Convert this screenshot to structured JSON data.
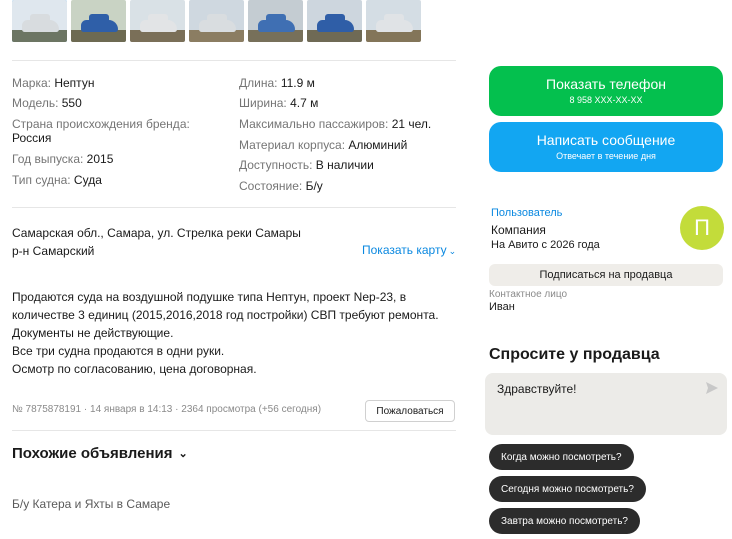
{
  "gallery": {
    "thumbnails": [
      {
        "name": "photo-1",
        "sky": "#dfe7ee",
        "boat": "#d8dcdf",
        "grass": "#6c7563"
      },
      {
        "name": "photo-2",
        "sky": "#c9d3c4",
        "boat": "#2f5fa8",
        "grass": "#6d6a52"
      },
      {
        "name": "photo-3",
        "sky": "#d9e1e6",
        "boat": "#e2e4e6",
        "grass": "#7a6f58"
      },
      {
        "name": "photo-4",
        "sky": "#cfd8e0",
        "boat": "#d9dde0",
        "grass": "#8b7d62"
      },
      {
        "name": "photo-5",
        "sky": "#c4ccd2",
        "boat": "#3f6fb3",
        "grass": "#77705a"
      },
      {
        "name": "photo-6",
        "sky": "#cdd6de",
        "boat": "#2f5ea7",
        "grass": "#6f6a55"
      },
      {
        "name": "photo-7",
        "sky": "#d4dde4",
        "boat": "#e0e3e6",
        "grass": "#837559"
      }
    ]
  },
  "specs": {
    "left": [
      {
        "key": "Марка:",
        "value": "Нептун"
      },
      {
        "key": "Модель:",
        "value": "550"
      },
      {
        "key": "Страна происхождения бренда:",
        "value": "Россия"
      },
      {
        "key": "Год выпуска:",
        "value": "2015"
      },
      {
        "key": "Тип судна:",
        "value": "Суда"
      }
    ],
    "right": [
      {
        "key": "Длина:",
        "value": "11.9 м"
      },
      {
        "key": "Ширина:",
        "value": "4.7 м"
      },
      {
        "key": "Максимально пассажиров:",
        "value": "21 чел."
      },
      {
        "key": "Материал корпуса:",
        "value": "Алюминий"
      },
      {
        "key": "Доступность:",
        "value": "В наличии"
      },
      {
        "key": "Состояние:",
        "value": "Б/у"
      }
    ]
  },
  "location": {
    "line1": "Самарская обл., Самара, ул. Стрелка реки Самары",
    "line2": "р-н Самарский",
    "map_link": "Показать карту"
  },
  "description": [
    "Продаются суда на воздушной подушке типа Нептун, проект Nep-23, в",
    "количестве 3 единиц (2015,2016,2018 год постройки) СВП требуют ремонта.",
    "Документы не действующие.",
    "Все три судна продаются в одни руки.",
    "Осмотр по согласованию, цена договорная."
  ],
  "meta": "№ 7875878191 · 14 января в 14:13 · 2364 просмотра (+56 сегодня)",
  "complain_label": "Пожаловаться",
  "similar_title": "Похожие объявления",
  "category_link": "Б/у Катера и Яхты в Самаре",
  "actions": {
    "phone_label": "Показать телефон",
    "phone_mask": "8 958 XXX-XX-XX",
    "message_label": "Написать сообщение",
    "message_sub": "Отвечает в течение дня",
    "phone_color": "#04c04e",
    "message_color": "#12a6f2"
  },
  "seller": {
    "role": "Пользователь",
    "name": "Компания",
    "since": "На Авито с 2026 года",
    "avatar_letter": "П",
    "avatar_color": "#c3dc3a",
    "subscribe_label": "Подписаться на продавца",
    "contact_label": "Контактное лицо",
    "contact_name": "Иван"
  },
  "ask": {
    "title": "Спросите у продавца",
    "message": "Здравствуйте!",
    "quick_questions": [
      "Когда можно посмотреть?",
      "Сегодня можно посмотреть?",
      "Завтра можно посмотреть?"
    ]
  }
}
